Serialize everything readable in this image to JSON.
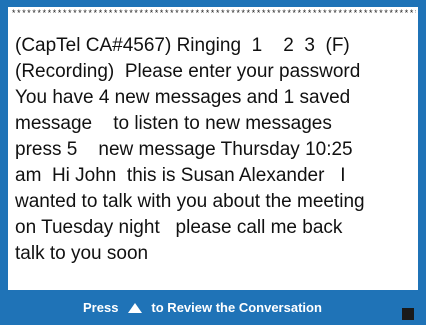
{
  "screen": {
    "separator": "**********************************************************************************************",
    "transcript": "(CapTel CA#4567) Ringing  1    2  3  (F)\n(Recording)  Please enter your password\nYou have 4 new messages and 1 saved\nmessage    to listen to new messages\npress 5    new message Thursday 10:25\nam  Hi John  this is Susan Alexander   I\nwanted to talk with you about the meeting\non Tuesday night   please call me back\ntalk to you soon"
  },
  "footer": {
    "press_label": "Press",
    "arrow_icon": "up-arrow-icon",
    "review_label": "to Review the Conversation",
    "stop_icon": "stop-square-icon"
  },
  "colors": {
    "frame": "#1f73b7",
    "background": "#ffffff",
    "text": "#111111"
  }
}
